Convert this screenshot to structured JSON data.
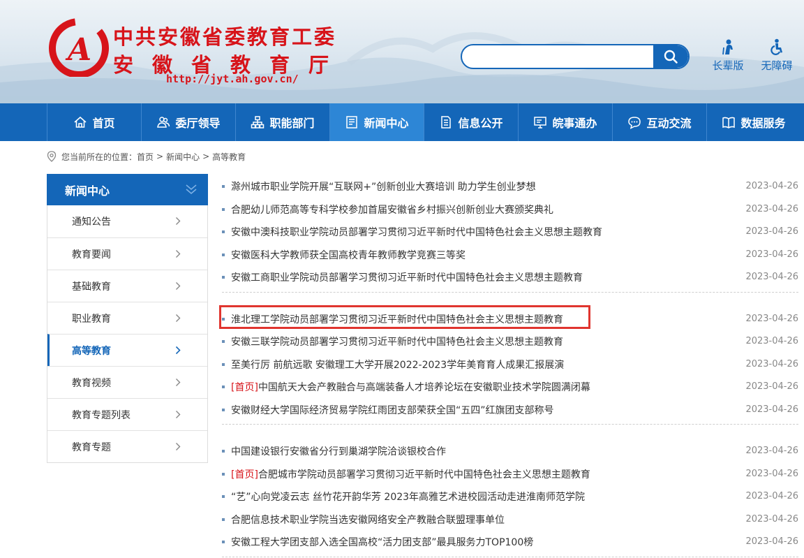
{
  "header": {
    "title": "中共安徽省委教育工委",
    "subtitle": "安徽省教育厅",
    "url": "http://jyt.ah.gov.cn/",
    "search_placeholder": "",
    "tools": [
      {
        "label": "长辈版",
        "icon": "elder-person-icon"
      },
      {
        "label": "无障碍",
        "icon": "accessibility-icon"
      }
    ]
  },
  "nav": {
    "items": [
      {
        "label": "首页",
        "icon": "home-icon"
      },
      {
        "label": "委厅领导",
        "icon": "leaders-icon"
      },
      {
        "label": "职能部门",
        "icon": "org-chart-icon"
      },
      {
        "label": "新闻中心",
        "icon": "news-icon",
        "active": true
      },
      {
        "label": "信息公开",
        "icon": "document-icon"
      },
      {
        "label": "皖事通办",
        "icon": "monitor-icon"
      },
      {
        "label": "互动交流",
        "icon": "chat-icon"
      },
      {
        "label": "数据服务",
        "icon": "book-icon"
      }
    ]
  },
  "breadcrumb": {
    "prefix": "您当前所在的位置：",
    "items": [
      "首页",
      "新闻中心",
      "高等教育"
    ],
    "separator": ">"
  },
  "sidebar": {
    "heading": "新闻中心",
    "items": [
      {
        "label": "通知公告"
      },
      {
        "label": "教育要闻"
      },
      {
        "label": "基础教育"
      },
      {
        "label": "职业教育"
      },
      {
        "label": "高等教育",
        "active": true
      },
      {
        "label": "教育视频"
      },
      {
        "label": "教育专题列表"
      },
      {
        "label": "教育专题"
      }
    ]
  },
  "news": {
    "groups": [
      [
        {
          "title": "滁州城市职业学院开展“互联网+”创新创业大赛培训 助力学生创业梦想",
          "date": "2023-04-26"
        },
        {
          "title": "合肥幼儿师范高等专科学校参加首届安徽省乡村振兴创新创业大赛颁奖典礼",
          "date": "2023-04-26"
        },
        {
          "title": "安徽中澳科技职业学院动员部署学习贯彻习近平新时代中国特色社会主义思想主题教育",
          "date": "2023-04-26"
        },
        {
          "title": "安徽医科大学教师获全国高校青年教师教学竞赛三等奖",
          "date": "2023-04-26"
        },
        {
          "title": "安徽工商职业学院动员部署学习贯彻习近平新时代中国特色社会主义思想主题教育",
          "date": "2023-04-26"
        }
      ],
      [
        {
          "title": "淮北理工学院动员部署学习贯彻习近平新时代中国特色社会主义思想主题教育",
          "date": "2023-04-26"
        },
        {
          "title": "安徽三联学院动员部署学习贯彻习近平新时代中国特色社会主义思想主题教育",
          "date": "2023-04-26"
        },
        {
          "title": "至美行厉 前航远歌 安徽理工大学开展2022-2023学年美育育人成果汇报展演",
          "date": "2023-04-26"
        },
        {
          "tag": "[首页]",
          "title": "中国航天大会产教融合与高端装备人才培养论坛在安徽职业技术学院圆满闭幕",
          "date": "2023-04-26"
        },
        {
          "title": "安徽财经大学国际经济贸易学院红雨团支部荣获全国“五四”红旗团支部称号",
          "date": "2023-04-26"
        }
      ],
      [
        {
          "title": "中国建设银行安徽省分行到巢湖学院洽谈银校合作",
          "date": "2023-04-26"
        },
        {
          "tag": "[首页]",
          "title": "合肥城市学院动员部署学习贯彻习近平新时代中国特色社会主义思想主题教育",
          "date": "2023-04-26"
        },
        {
          "title": "“艺”心向党凌云志 丝竹花开韵华芳 2023年高雅艺术进校园活动走进淮南师范学院",
          "date": "2023-04-26"
        },
        {
          "title": "合肥信息技术职业学院当选安徽网络安全产教融合联盟理事单位",
          "date": "2023-04-26"
        },
        {
          "title": "安徽工程大学团支部入选全国高校“活力团支部”最具服务力TOP100榜",
          "date": "2023-04-26"
        }
      ]
    ]
  },
  "colors": {
    "brand_blue": "#1466b8",
    "active_nav": "#2d86d6",
    "brand_red": "#d7141a",
    "highlight": "#e0352f"
  }
}
